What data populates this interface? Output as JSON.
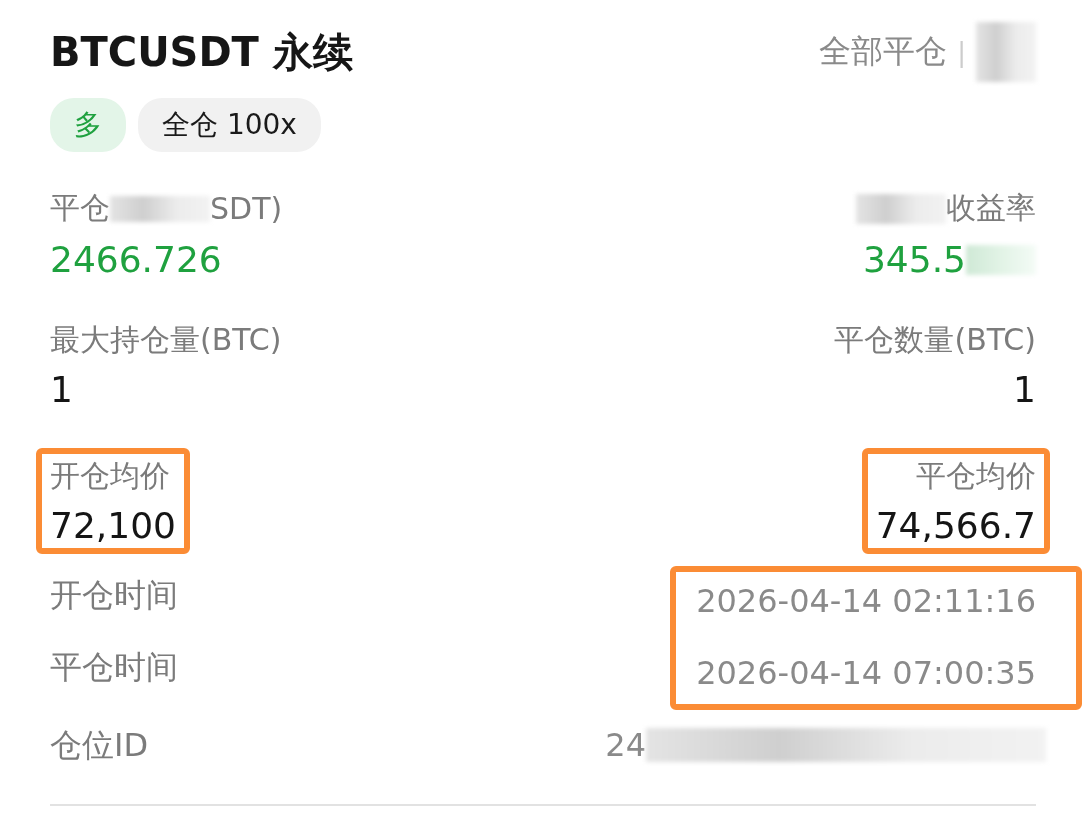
{
  "header": {
    "title": "BTCUSDT 永续",
    "close_all": "全部平仓",
    "separator": "|"
  },
  "tags": [
    {
      "label": "多",
      "kind": "side"
    },
    {
      "label": "全仓 100x",
      "kind": "margin"
    }
  ],
  "pnl": {
    "label_parts": [
      "平仓",
      "SDT)"
    ],
    "value": "2466.726"
  },
  "roi": {
    "label": "收益率",
    "value": "345.5"
  },
  "field_rows": [
    {
      "left": {
        "label": "最大持仓量(BTC)",
        "value": "1",
        "highlighted": false
      },
      "right": {
        "label": "平仓数量(BTC)",
        "value": "1",
        "highlighted": false
      }
    },
    {
      "left": {
        "label": "开仓均价",
        "value": "72,100",
        "highlighted": true
      },
      "right": {
        "label": "平仓均价",
        "value": "74,566.7",
        "highlighted": true
      }
    }
  ],
  "times": {
    "highlighted": true,
    "items": [
      {
        "label": "开仓时间",
        "value": "2026-04-14 02:11:16"
      },
      {
        "label": "平仓时间",
        "value": "2026-04-14 07:00:35"
      }
    ]
  },
  "position_id": {
    "label": "仓位ID",
    "value": "24"
  }
}
